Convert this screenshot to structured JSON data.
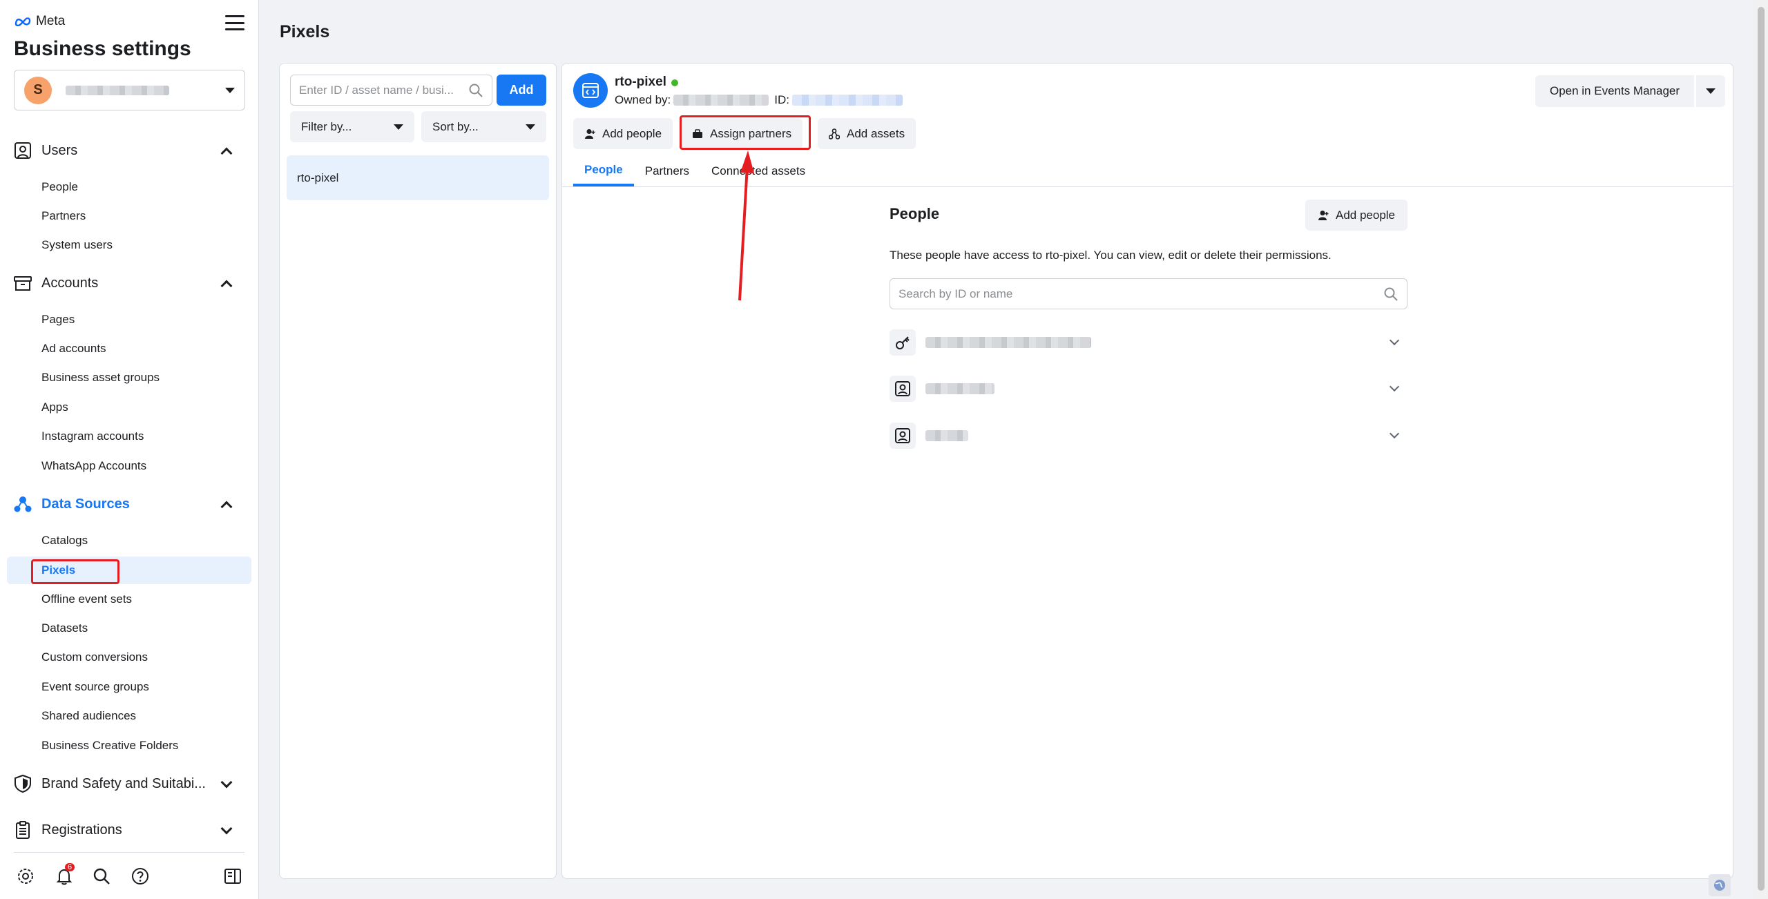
{
  "brand": {
    "name": "Meta"
  },
  "sidebar": {
    "title": "Business settings",
    "business_avatar_letter": "S",
    "sections": [
      {
        "label": "Users",
        "items": [
          "People",
          "Partners",
          "System users"
        ]
      },
      {
        "label": "Accounts",
        "items": [
          "Pages",
          "Ad accounts",
          "Business asset groups",
          "Apps",
          "Instagram accounts",
          "WhatsApp Accounts"
        ]
      },
      {
        "label": "Data Sources",
        "items": [
          "Catalogs",
          "Pixels",
          "Offline event sets",
          "Datasets",
          "Custom conversions",
          "Event source groups",
          "Shared audiences",
          "Business Creative Folders"
        ]
      },
      {
        "label": "Brand Safety and Suitabi..."
      },
      {
        "label": "Registrations"
      }
    ],
    "notifications_count": "6"
  },
  "main": {
    "title": "Pixels",
    "search_placeholder": "Enter ID / asset name / busi...",
    "add_label": "Add",
    "filter_label": "Filter by...",
    "sort_label": "Sort by...",
    "list_items": [
      "rto-pixel"
    ]
  },
  "detail": {
    "asset_name": "rto-pixel",
    "owned_by_label": "Owned by:",
    "id_label": "ID:",
    "open_events_manager": "Open in Events Manager",
    "actions": {
      "add_people": "Add people",
      "assign_partners": "Assign partners",
      "add_assets": "Add assets"
    },
    "tabs": [
      "People",
      "Partners",
      "Connected assets"
    ],
    "people": {
      "title": "People",
      "add_people": "Add people",
      "description": "These people have access to rto-pixel. You can view, edit or delete their permissions.",
      "search_placeholder": "Search by ID or name"
    }
  },
  "colors": {
    "accent": "#1877f2",
    "highlight": "#e41e20",
    "status_active": "#42b72a"
  }
}
